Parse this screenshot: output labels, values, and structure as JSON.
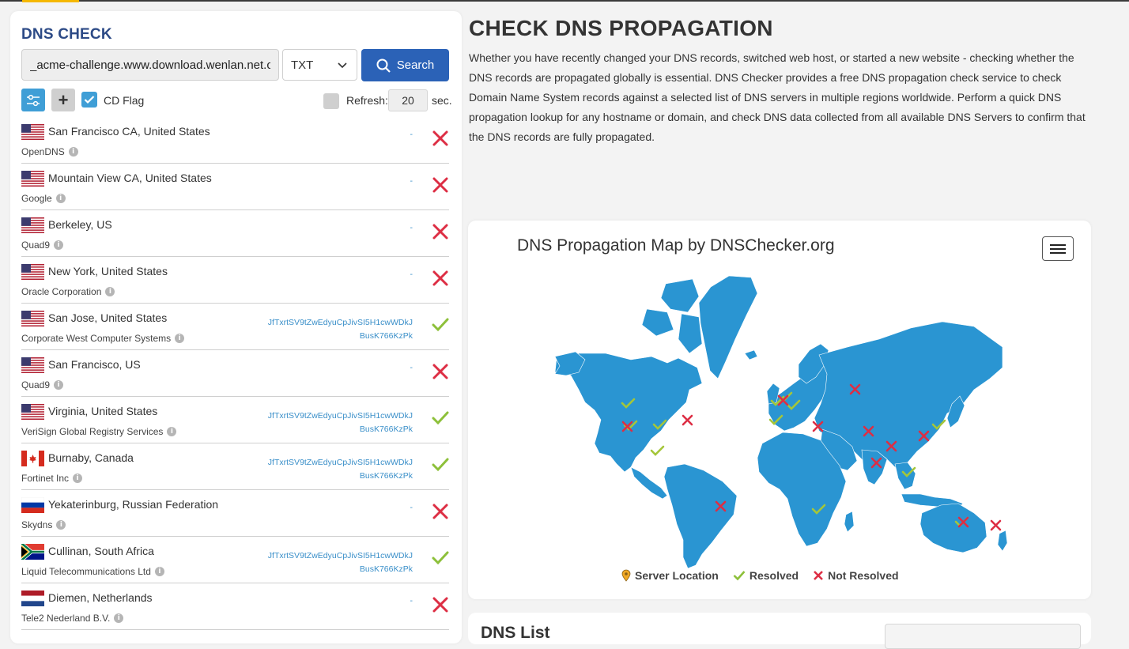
{
  "left": {
    "title": "DNS CHECK",
    "hostname_value": "_acme-challenge.www.download.wenlan.net.cn",
    "record_type": "TXT",
    "search_label": "Search",
    "cd_flag_label": "CD Flag",
    "refresh_label": "Refresh:",
    "refresh_value": "20",
    "sec_label": "sec.",
    "rows": [
      {
        "flag": "us",
        "location": "San Francisco CA, United States",
        "provider": "OpenDNS",
        "result": "-",
        "status": "fail"
      },
      {
        "flag": "us",
        "location": "Mountain View CA, United States",
        "provider": "Google",
        "result": "-",
        "status": "fail"
      },
      {
        "flag": "us",
        "location": "Berkeley, US",
        "provider": "Quad9",
        "result": "-",
        "status": "fail"
      },
      {
        "flag": "us",
        "location": "New York, United States",
        "provider": "Oracle Corporation",
        "result": "-",
        "status": "fail"
      },
      {
        "flag": "us",
        "location": "San Jose, United States",
        "provider": "Corporate West Computer Systems",
        "result": "JfTxrtSV9tZwEdyuCpJivSI5H1cwWDkJ",
        "result2": "BusK766KzPk",
        "status": "ok"
      },
      {
        "flag": "us",
        "location": "San Francisco, US",
        "provider": "Quad9",
        "result": "-",
        "status": "fail"
      },
      {
        "flag": "us",
        "location": "Virginia, United States",
        "provider": "VeriSign Global Registry Services",
        "result": "JfTxrtSV9tZwEdyuCpJivSI5H1cwWDkJ",
        "result2": "BusK766KzPk",
        "status": "ok"
      },
      {
        "flag": "ca",
        "location": "Burnaby, Canada",
        "provider": "Fortinet Inc",
        "result": "JfTxrtSV9tZwEdyuCpJivSI5H1cwWDkJ",
        "result2": "BusK766KzPk",
        "status": "ok"
      },
      {
        "flag": "ru",
        "location": "Yekaterinburg, Russian Federation",
        "provider": "Skydns",
        "result": "-",
        "status": "fail"
      },
      {
        "flag": "za",
        "location": "Cullinan, South Africa",
        "provider": "Liquid Telecommunications Ltd",
        "result": "JfTxrtSV9tZwEdyuCpJivSI5H1cwWDkJ",
        "result2": "BusK766KzPk",
        "status": "ok"
      },
      {
        "flag": "nl",
        "location": "Diemen, Netherlands",
        "provider": "Tele2 Nederland B.V.",
        "result": "-",
        "status": "fail"
      }
    ]
  },
  "main": {
    "title": "CHECK DNS PROPAGATION",
    "description": "Whether you have recently changed your DNS records, switched web host, or started a new website - checking whether the DNS records are propagated globally is essential. DNS Checker provides a free DNS propagation check service to check Domain Name System records against a selected list of DNS servers in multiple regions worldwide. Perform a quick DNS propagation lookup for any hostname or domain, and check DNS data collected from all available DNS Servers to confirm that the DNS records are fully propagated."
  },
  "map": {
    "title": "DNS Propagation Map by DNSChecker.org",
    "legend": {
      "server_location": "Server Location",
      "resolved": "Resolved",
      "not_resolved": "Not Resolved"
    }
  },
  "list": {
    "title": "DNS List"
  },
  "colors": {
    "brand_blue": "#2b62b7",
    "accent": "#3f9ed6",
    "ok": "#8dc03a",
    "fail": "#dd2e44",
    "map_land": "#2a95d2"
  }
}
